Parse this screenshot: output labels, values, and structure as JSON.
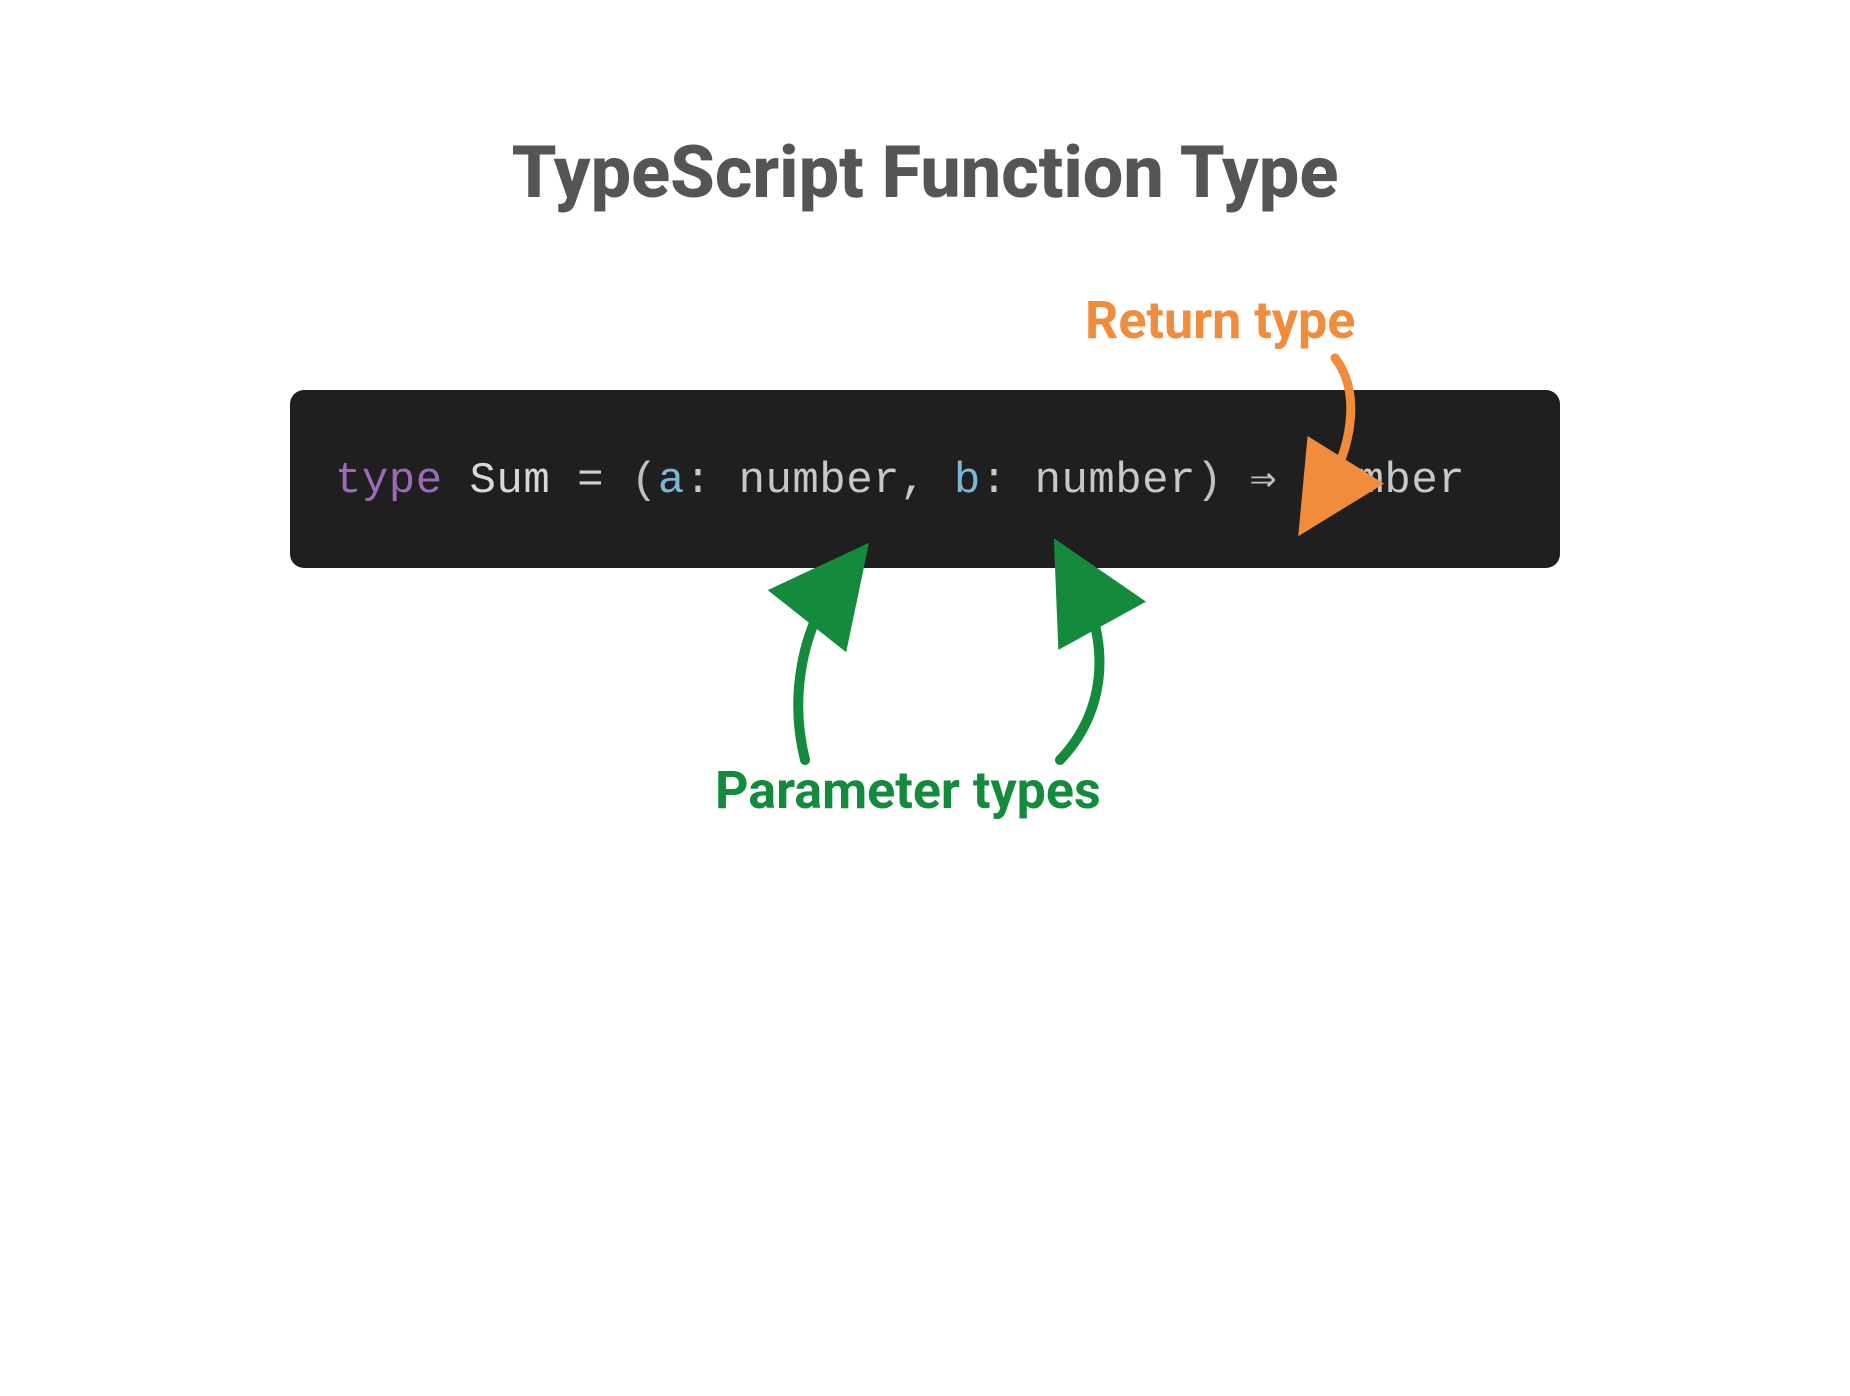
{
  "title": "TypeScript Function Type",
  "labels": {
    "return_type": "Return type",
    "parameter_types": "Parameter types"
  },
  "code": {
    "keyword": "type",
    "typename": "Sum",
    "equals": "=",
    "open_paren": "(",
    "param1_name": "a",
    "colon1": ":",
    "param1_type": "number",
    "comma": ",",
    "param2_name": "b",
    "colon2": ":",
    "param2_type": "number",
    "close_paren": ")",
    "arrow": "⇒",
    "return_type": "number"
  },
  "colors": {
    "title": "#555555",
    "return_label": "#f08c3b",
    "param_label": "#138a3c",
    "code_bg": "#1f1f1f",
    "keyword": "#9d6ab7",
    "param": "#7eb6d6"
  }
}
